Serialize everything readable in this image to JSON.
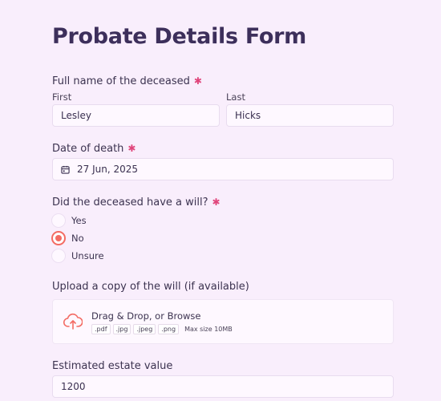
{
  "form": {
    "title": "Probate Details Form",
    "required_mark": "✱"
  },
  "deceased_name": {
    "label": "Full name of the deceased",
    "first_label": "First",
    "last_label": "Last",
    "first_value": "Lesley",
    "last_value": "Hicks"
  },
  "date_of_death": {
    "label": "Date of death",
    "value": "27 Jun, 2025",
    "icon": "calendar-icon"
  },
  "will": {
    "label": "Did the deceased have a will?",
    "options": [
      {
        "label": "Yes",
        "checked": false
      },
      {
        "label": "No",
        "checked": true
      },
      {
        "label": "Unsure",
        "checked": false
      }
    ]
  },
  "upload": {
    "label": "Upload a copy of the will (if available)",
    "main_text": "Drag & Drop, or Browse",
    "extensions": [
      ".pdf",
      ".jpg",
      ".jpeg",
      ".png"
    ],
    "max_size": "Max size 10MB",
    "icon": "cloud-upload-icon",
    "accent_color": "#f36b63"
  },
  "estate": {
    "label": "Estimated estate value",
    "value": "1200"
  },
  "colors": {
    "background": "#f9eefc",
    "title": "#3d2f5b",
    "required": "#e0457b",
    "radio_checked": "#f36b63"
  }
}
